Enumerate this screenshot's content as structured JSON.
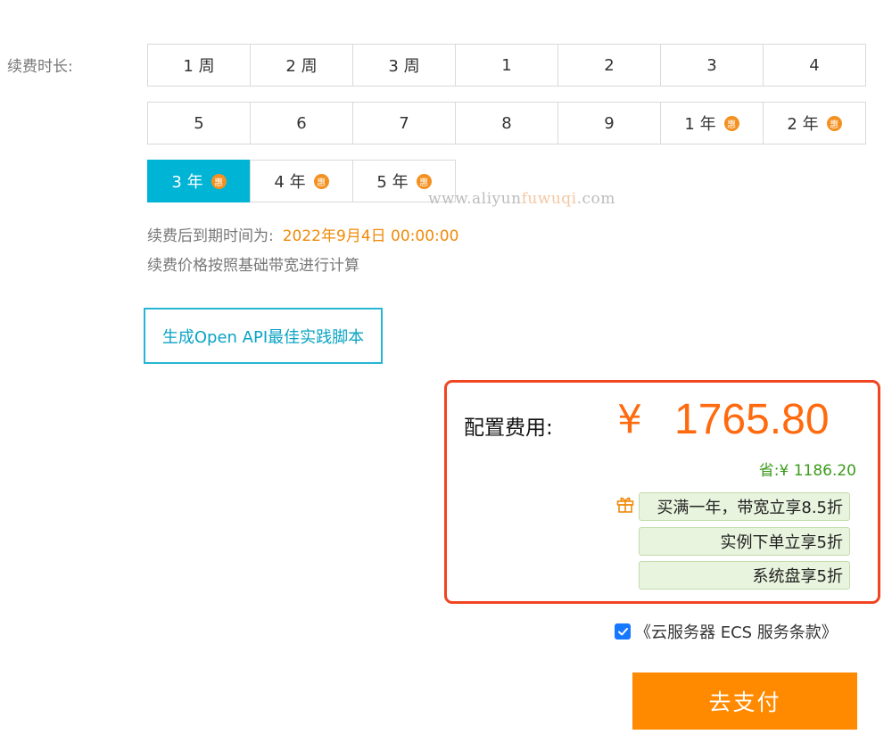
{
  "renewal": {
    "label": "续费时长:",
    "rows": [
      [
        {
          "text": "1 周",
          "hui": ""
        },
        {
          "text": "2 周",
          "hui": ""
        },
        {
          "text": "3 周",
          "hui": ""
        },
        {
          "text": "1",
          "hui": ""
        },
        {
          "text": "2",
          "hui": ""
        },
        {
          "text": "3",
          "hui": ""
        },
        {
          "text": "4",
          "hui": ""
        }
      ],
      [
        {
          "text": "5",
          "hui": ""
        },
        {
          "text": "6",
          "hui": ""
        },
        {
          "text": "7",
          "hui": ""
        },
        {
          "text": "8",
          "hui": ""
        },
        {
          "text": "9",
          "hui": ""
        },
        {
          "text": "1 年",
          "hui": "惠"
        },
        {
          "text": "2 年",
          "hui": "惠"
        }
      ],
      [
        {
          "text": "3 年",
          "hui": "惠"
        },
        {
          "text": "4 年",
          "hui": "惠"
        },
        {
          "text": "5 年",
          "hui": "惠"
        }
      ]
    ],
    "selected": "3 年",
    "expiry_label": "续费后到期时间为:",
    "expiry_date": "2022年9月4日 00:00:00",
    "price_note": "续费价格按照基础带宽进行计算"
  },
  "watermark": {
    "part1": "www.aliyun",
    "part2": "fuwuqi",
    "part3": ".com"
  },
  "api_button": "生成Open API最佳实践脚本",
  "cost": {
    "label": "配置费用:",
    "currency": "¥",
    "amount": "1765.80",
    "saving": "省:¥ 1186.20",
    "gift_icon": "gift-icon",
    "promotions": [
      "买满一年，带宽立享8.5折",
      "实例下单立享5折",
      "系统盘享5折"
    ]
  },
  "terms": {
    "checked": true,
    "text": "《云服务器 ECS 服务条款》"
  },
  "pay_button": "去支付",
  "colors": {
    "accent": "#00b4d6",
    "price": "#ff6a0e",
    "pay": "#ff8a00",
    "highlight_box": "#f04520",
    "saving": "#3a9b1c"
  }
}
